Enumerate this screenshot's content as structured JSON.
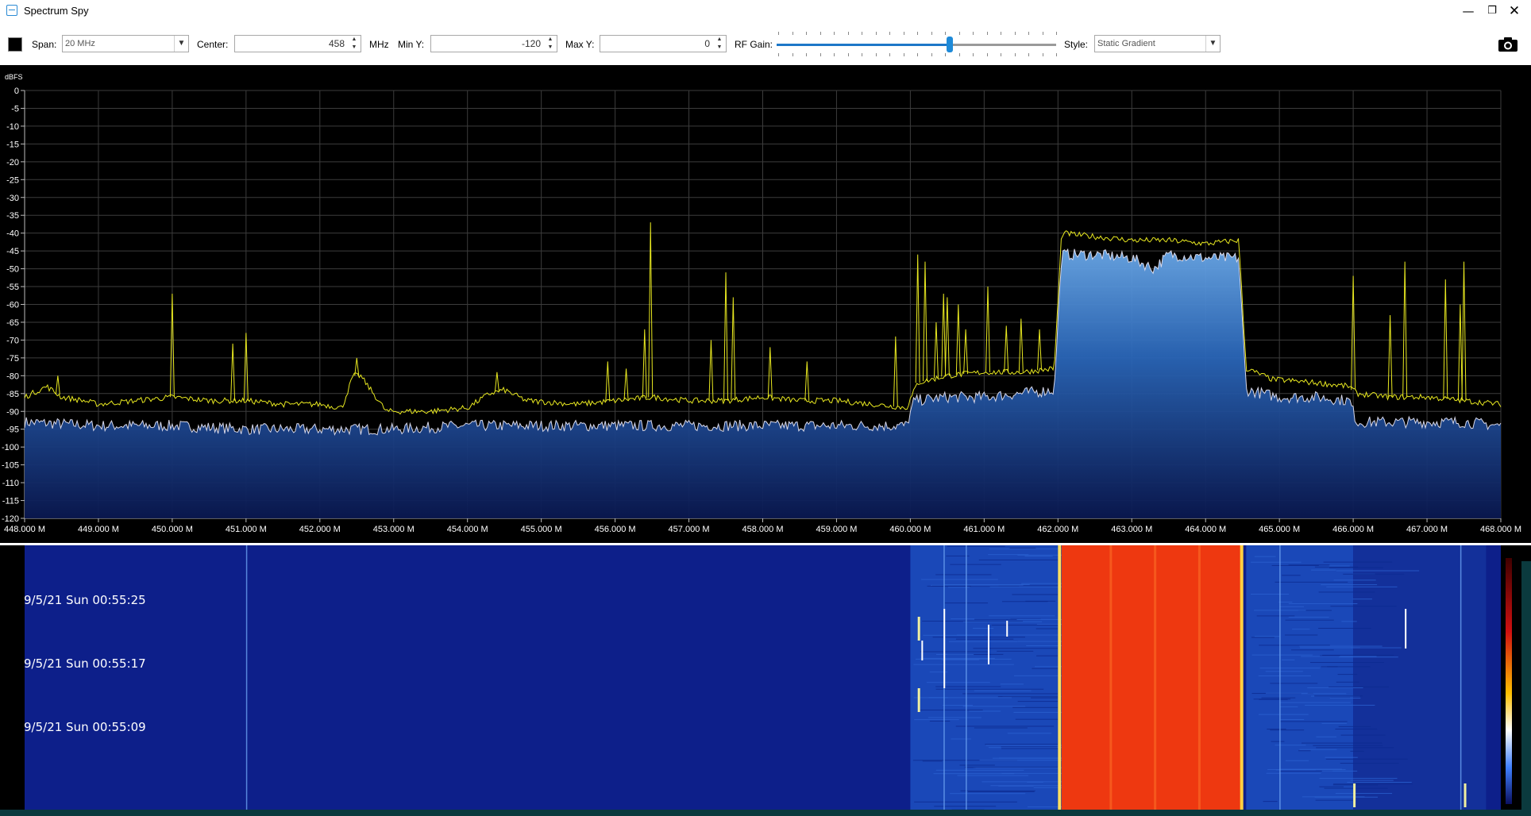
{
  "window": {
    "title": "Spectrum Spy",
    "minimize": "—",
    "maximize": "❐",
    "close": "✕"
  },
  "toolbar": {
    "span_label": "Span:",
    "span_value": "20 MHz",
    "center_label": "Center:",
    "center_value": "458",
    "center_unit": "MHz",
    "min_y_label": "Min Y:",
    "min_y_value": "-120",
    "max_y_label": "Max Y:",
    "max_y_value": "0",
    "rf_gain_label": "RF Gain:",
    "rf_gain_level": 0.62,
    "style_label": "Style:",
    "style_value": "Static Gradient",
    "colors": {
      "accent": "#1e78c8"
    }
  },
  "chart_data": {
    "type": "line",
    "ylabel": "dBFS",
    "ylim": [
      -120,
      0
    ],
    "yticks": [
      0,
      -5,
      -10,
      -15,
      -20,
      -25,
      -30,
      -35,
      -40,
      -45,
      -50,
      -55,
      -60,
      -65,
      -70,
      -75,
      -80,
      -85,
      -90,
      -95,
      -100,
      -105,
      -110,
      -115,
      -120
    ],
    "xlim": [
      448.0,
      468.0
    ],
    "xtick_labels": [
      "448.000 M",
      "449.000 M",
      "450.000 M",
      "451.000 M",
      "452.000 M",
      "453.000 M",
      "454.000 M",
      "455.000 M",
      "456.000 M",
      "457.000 M",
      "458.000 M",
      "459.000 M",
      "460.000 M",
      "461.000 M",
      "462.000 M",
      "463.000 M",
      "464.000 M",
      "465.000 M",
      "466.000 M",
      "467.000 M",
      "468.000 M"
    ],
    "grid": true,
    "series": [
      {
        "color": "#e8e820",
        "x": [
          448.0,
          448.3,
          448.5,
          448.8,
          449.0,
          449.5,
          450.0,
          450.5,
          451.0,
          451.5,
          452.0,
          452.3,
          452.45,
          452.55,
          452.9,
          453.5,
          454.0,
          454.3,
          454.5,
          454.8,
          455.5,
          456.0,
          456.5,
          457.0,
          457.5,
          458.0,
          458.5,
          459.0,
          459.5,
          459.95,
          460.1,
          460.5,
          461.0,
          461.5,
          461.95,
          462.05,
          462.5,
          463.0,
          463.5,
          464.0,
          464.45,
          464.55,
          464.9,
          465.5,
          465.95,
          466.05,
          466.5,
          467.0,
          467.5,
          468.0
        ],
        "values": [
          -86,
          -83,
          -86,
          -87,
          -88,
          -87,
          -86,
          -87,
          -87,
          -88,
          -88,
          -89,
          -80,
          -80,
          -90,
          -90,
          -89,
          -85,
          -84,
          -87,
          -88,
          -87,
          -86,
          -87,
          -87,
          -86,
          -87,
          -87,
          -88,
          -89,
          -82,
          -80,
          -79,
          -79,
          -78,
          -40,
          -41,
          -42,
          -42,
          -43,
          -42,
          -78,
          -81,
          -82,
          -83,
          -85,
          -86,
          -86,
          -87,
          -88
        ]
      },
      {
        "color": "#d8d8e8",
        "x": [
          448.0,
          449.0,
          450.0,
          451.0,
          452.0,
          453.0,
          454.0,
          455.0,
          456.0,
          457.0,
          458.0,
          459.0,
          459.95,
          460.05,
          460.5,
          461.0,
          461.95,
          462.05,
          462.5,
          463.0,
          463.3,
          463.5,
          464.0,
          464.45,
          464.55,
          465.0,
          465.5,
          465.95,
          466.05,
          466.5,
          467.0,
          467.5,
          468.0
        ],
        "values": [
          -93,
          -94,
          -94,
          -95,
          -95,
          -95,
          -94,
          -94,
          -94,
          -94,
          -94,
          -94,
          -94,
          -87,
          -86,
          -86,
          -84,
          -46,
          -46,
          -47,
          -50,
          -46,
          -47,
          -47,
          -84,
          -86,
          -86,
          -87,
          -93,
          -93,
          -93,
          -93,
          -94
        ]
      }
    ],
    "peaks": [
      {
        "x": 448.45,
        "y": -80
      },
      {
        "x": 450.0,
        "y": -57
      },
      {
        "x": 450.82,
        "y": -71
      },
      {
        "x": 451.0,
        "y": -68
      },
      {
        "x": 452.5,
        "y": -75
      },
      {
        "x": 454.4,
        "y": -79
      },
      {
        "x": 455.9,
        "y": -76
      },
      {
        "x": 456.15,
        "y": -78
      },
      {
        "x": 456.4,
        "y": -67
      },
      {
        "x": 456.48,
        "y": -37
      },
      {
        "x": 457.3,
        "y": -70
      },
      {
        "x": 457.5,
        "y": -51
      },
      {
        "x": 457.6,
        "y": -58
      },
      {
        "x": 458.1,
        "y": -72
      },
      {
        "x": 458.6,
        "y": -76
      },
      {
        "x": 459.8,
        "y": -69
      },
      {
        "x": 460.1,
        "y": -46
      },
      {
        "x": 460.2,
        "y": -48
      },
      {
        "x": 460.35,
        "y": -65
      },
      {
        "x": 460.45,
        "y": -57
      },
      {
        "x": 460.5,
        "y": -58
      },
      {
        "x": 460.65,
        "y": -60
      },
      {
        "x": 460.75,
        "y": -67
      },
      {
        "x": 461.05,
        "y": -55
      },
      {
        "x": 461.3,
        "y": -66
      },
      {
        "x": 461.5,
        "y": -64
      },
      {
        "x": 461.75,
        "y": -67
      },
      {
        "x": 466.0,
        "y": -52
      },
      {
        "x": 466.5,
        "y": -63
      },
      {
        "x": 466.7,
        "y": -48
      },
      {
        "x": 467.25,
        "y": -53
      },
      {
        "x": 467.45,
        "y": -60
      },
      {
        "x": 467.5,
        "y": -48
      }
    ]
  },
  "waterfall": {
    "timestamps": [
      "9/5/21 Sun 00:55:25",
      "9/5/21 Sun 00:55:17",
      "9/5/21 Sun 00:55:09"
    ],
    "colors": {
      "base": "#0d1f8a",
      "active": "#1a48b8",
      "hot": "#ee3810"
    }
  }
}
